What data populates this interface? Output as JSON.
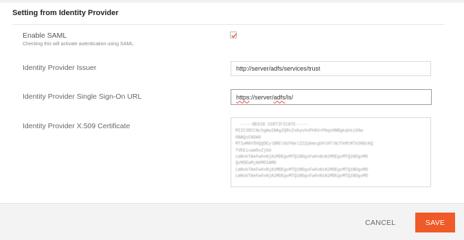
{
  "section": {
    "title": "Setting from Identity Provider"
  },
  "saml": {
    "label": "Enable SAML",
    "hint": "Checking this will activate autentication using SAML.",
    "checked": true,
    "check_color": "#f05a28"
  },
  "issuer": {
    "label": "Identity Provider Issuer",
    "value": "http://server/adfs/services/trust"
  },
  "sso_url": {
    "label": "Identity Provider Single Sign-On URL",
    "value_parts": [
      "https",
      "://server/",
      "adfs",
      "/ls/"
    ]
  },
  "certificate": {
    "label": "Identity Provider X.509 Certificate",
    "lines": [
      "-----BEGIN CERTIFICATE-----",
      "MIIC3DCCAcSgAwIBAgIQRcZsKyuVxPhKU+PKqzHNBgkqhkiG9w",
      "0BAQsFADA0",
      "MTIwMAYDVQQDEylBRElGUYWxlZ2ZpbmcgU0lHTlNJTkMtNTk5NDcKQ",
      "TVEEisam5vZjOd",
      "LmNvbTAeFw0xNjA1MDEgvMTQ1NDgxFw0xNzA1MDEgvMTQ1NDgxMD",
      "QxMDEwMjA0MDIAMD",
      "LmNvbTAeFw0xNjA1MDEgvMTQ1NDgxFw0xNzA1MDEgvMTQ1NDgxMD",
      "LmNvbTAeFw0xNjA1MDEgvMTQ1NDgxFw0xNzA1MDEgvMTQ1NDgxMD"
    ]
  },
  "footer": {
    "cancel_label": "CANCEL",
    "save_label": "SAVE",
    "save_color": "#f05a28"
  }
}
